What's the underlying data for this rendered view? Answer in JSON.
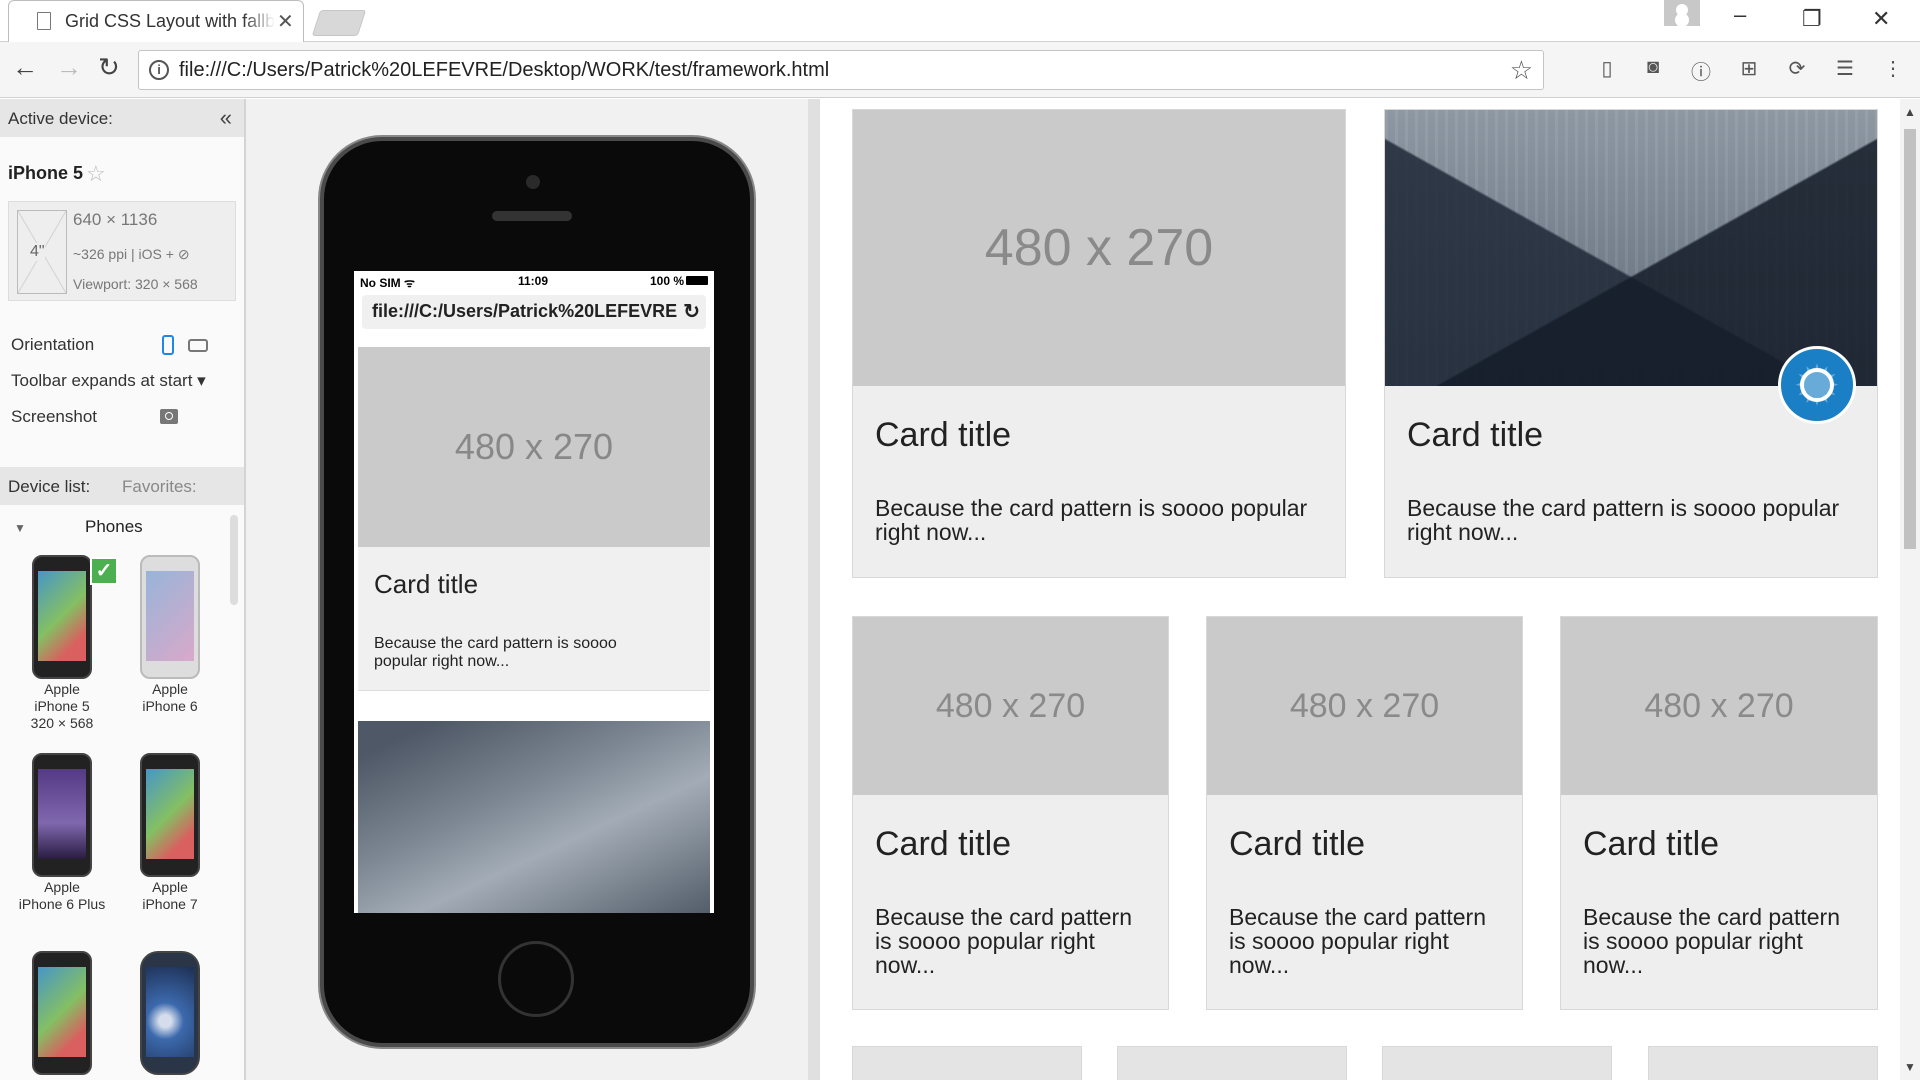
{
  "browser": {
    "tab_title": "Grid CSS Layout with fallb",
    "tab_close": "✕",
    "url": "file:///C:/Users/Patrick%20LEFEVRE/Desktop/WORK/test/framework.html"
  },
  "emulator": {
    "active_device_label": "Active device:",
    "collapse_glyph": "«",
    "device_name": "iPhone 5",
    "screen_size": "4\"",
    "resolution": "640 × 1136",
    "ppi": "~326 ppi | iOS + ⊘",
    "viewport": "Viewport: 320 × 568",
    "orientation_label": "Orientation",
    "toolbar_label": "Toolbar expands at start ▾",
    "screenshot_label": "Screenshot",
    "device_list_label": "Device list:",
    "favorites_label": "Favorites:",
    "group_label": "Phones",
    "phones": [
      {
        "line1": "Apple",
        "line2": "iPhone 5",
        "line3": "320 × 568"
      },
      {
        "line1": "Apple",
        "line2": "iPhone 6",
        "line3": ""
      },
      {
        "line1": "Apple",
        "line2": "iPhone 6 Plus",
        "line3": ""
      },
      {
        "line1": "Apple",
        "line2": "iPhone 7",
        "line3": ""
      }
    ]
  },
  "mobile": {
    "carrier": "No SIM ᯤ",
    "time": "11:09",
    "battery": "100 %",
    "url": "file:///C:/Users/Patrick%20LEFEVRE",
    "reload": "↻",
    "placeholder": "480 x 270",
    "card_title": "Card title",
    "card_text": "Because the card pattern is soooo popular right now..."
  },
  "cards": {
    "placeholder": "480 x 270",
    "title": "Card title",
    "text": "Because the card pattern is soooo popular right now..."
  }
}
